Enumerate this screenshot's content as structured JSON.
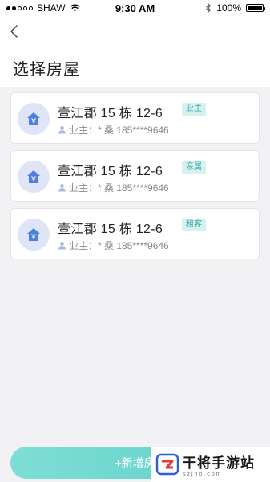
{
  "status_bar": {
    "carrier": "SHAW",
    "time": "9:30 AM",
    "battery": "100%",
    "signal_dots": [
      true,
      true,
      false,
      false,
      false
    ]
  },
  "header": {
    "title": "选择房屋"
  },
  "houses": [
    {
      "title": "壹江郡 15 栋 12-6",
      "role": "业主",
      "owner": "业主：* 桑 185****9646"
    },
    {
      "title": "壹江郡 15 栋 12-6",
      "role": "亲属",
      "owner": "业主：* 桑 185****9646"
    },
    {
      "title": "壹江郡 15 栋 12-6",
      "role": "租客",
      "owner": "业主：* 桑 185****9646"
    }
  ],
  "add_button": {
    "label": "+新增房"
  },
  "watermark": {
    "title": "干将手游站",
    "subtitle": "szjho.com"
  },
  "colors": {
    "accent": "#5fd0c6",
    "tag_bg": "#d6f2f0",
    "tag_text": "#39a9a2",
    "avatar_bg": "#dfe5f7",
    "avatar_icon": "#4f7ee3"
  }
}
